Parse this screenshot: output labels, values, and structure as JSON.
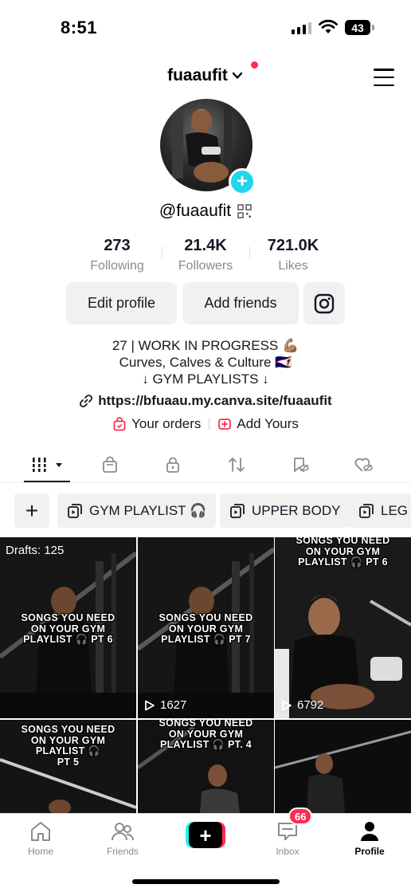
{
  "status_bar": {
    "time": "8:51",
    "battery": "43"
  },
  "header": {
    "username": "fuaaufit",
    "menu_icon": "hamburger-menu-icon"
  },
  "profile": {
    "handle": "@fuaaufit",
    "stats": [
      {
        "value": "273",
        "label": "Following"
      },
      {
        "value": "21.4K",
        "label": "Followers"
      },
      {
        "value": "721.0K",
        "label": "Likes"
      }
    ],
    "buttons": {
      "edit": "Edit profile",
      "add_friends": "Add friends"
    },
    "bio": [
      "27 | WORK IN PROGRESS 💪🏽",
      "Curves, Calves & Culture 🇦🇸",
      "↓ GYM PLAYLISTS ↓"
    ],
    "link": "https://bfuaau.my.canva.site/fuaaufit",
    "your_orders": "Your orders",
    "add_yours": "Add Yours"
  },
  "tabs": [
    "videos-grid",
    "shop",
    "private",
    "reposts",
    "saved",
    "liked"
  ],
  "playlists": [
    "GYM PLAYLIST 🎧",
    "UPPER BODY",
    "LEG D"
  ],
  "videos": [
    {
      "caption": "SONGS YOU NEED\nON YOUR GYM\nPLAYLIST 🎧 PT 6",
      "overlay": "Drafts: 125"
    },
    {
      "caption": "SONGS YOU NEED\nON YOUR GYM\nPLAYLIST 🎧 PT 7",
      "views": "1627"
    },
    {
      "caption": "SONGS YOU NEED\nON YOUR GYM\nPLAYLIST 🎧 PT 6",
      "views": "6792"
    },
    {
      "caption": "SONGS YOU NEED\nON YOUR GYM\nPLAYLIST 🎧\nPT 5"
    },
    {
      "caption": "SONGS YOU NEED\nON YOUR GYM\nPLAYLIST 🎧 PT. 4"
    },
    {
      "caption": ""
    }
  ],
  "bottom_nav": {
    "home": "Home",
    "friends": "Friends",
    "inbox": "Inbox",
    "inbox_badge": "66",
    "profile": "Profile"
  },
  "colors": {
    "accent_red": "#fe2c55",
    "accent_cyan": "#20d5ec",
    "chip_bg": "#f1f1f2"
  }
}
